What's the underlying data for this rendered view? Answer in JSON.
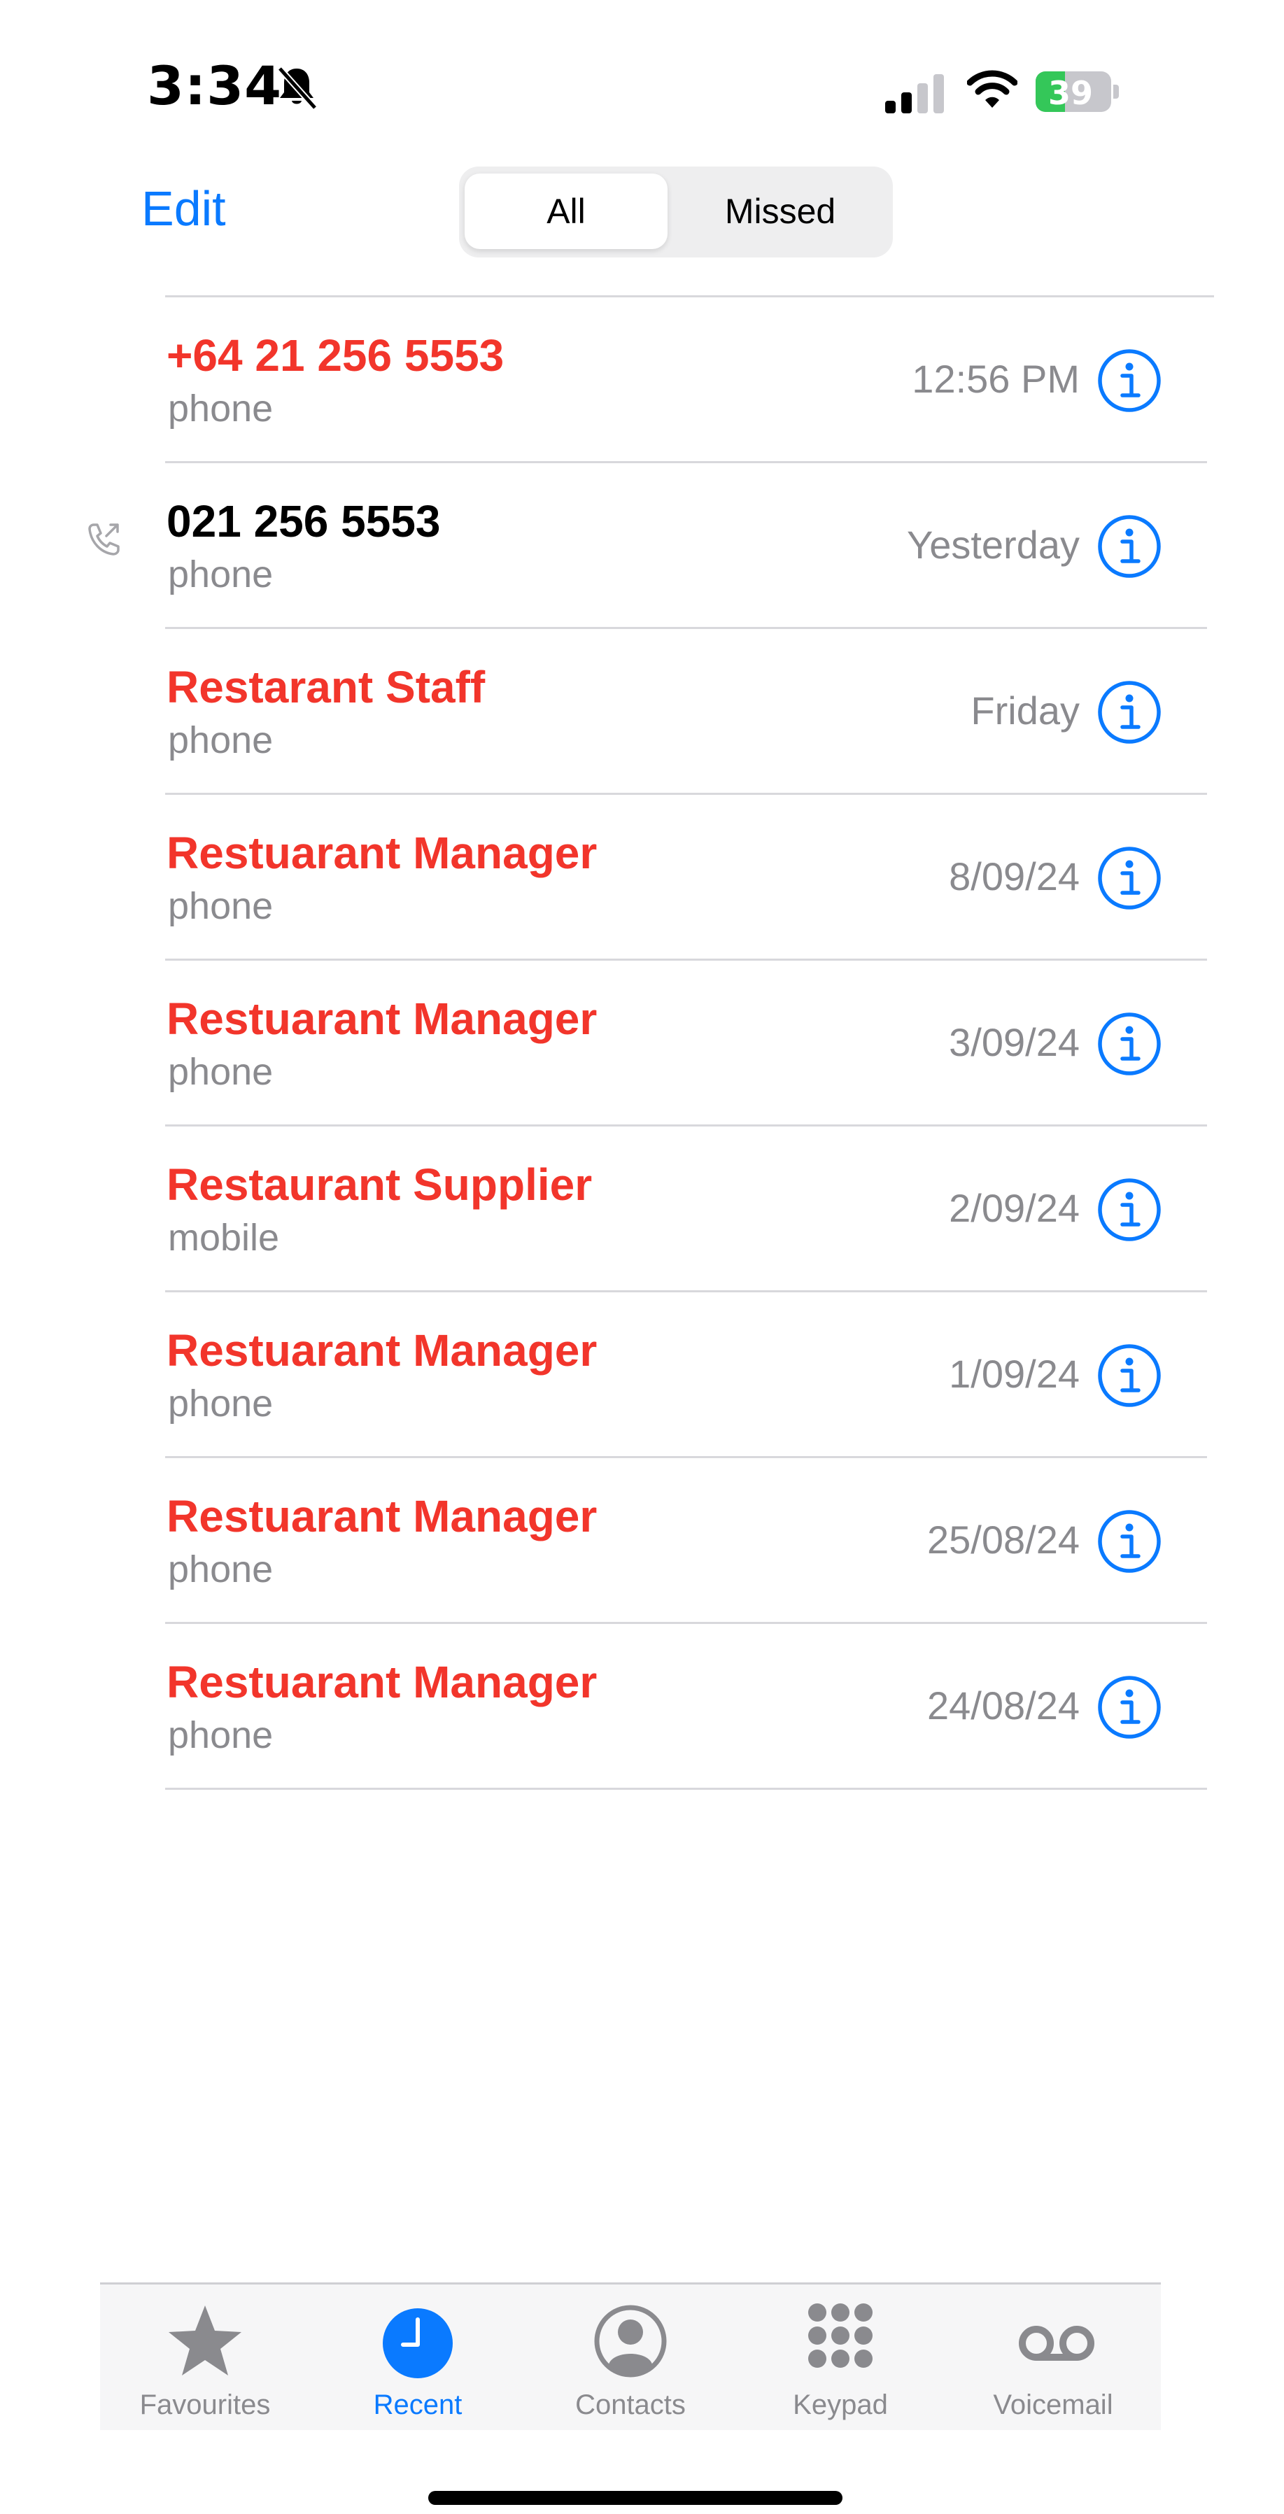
{
  "status_bar": {
    "time": "3:34",
    "battery_level": "39",
    "battery_fraction": 0.39
  },
  "header": {
    "edit_label": "Edit",
    "segments": [
      "All",
      "Missed"
    ],
    "selected_segment": "All"
  },
  "calls": [
    {
      "name": "+64 21 256 5553",
      "type": "phone",
      "time": "12:56 PM",
      "missed": true,
      "outgoing": false
    },
    {
      "name": "021 256 5553",
      "type": "phone",
      "time": "Yesterday",
      "missed": false,
      "outgoing": true
    },
    {
      "name": "Restarant Staff",
      "type": "phone",
      "time": "Friday",
      "missed": true,
      "outgoing": false
    },
    {
      "name": "Restuarant Manager",
      "type": "phone",
      "time": "8/09/24",
      "missed": true,
      "outgoing": false
    },
    {
      "name": "Restuarant Manager",
      "type": "phone",
      "time": "3/09/24",
      "missed": true,
      "outgoing": false
    },
    {
      "name": "Restaurant Supplier",
      "type": "mobile",
      "time": "2/09/24",
      "missed": true,
      "outgoing": false
    },
    {
      "name": "Restuarant Manager",
      "type": "phone",
      "time": "1/09/24",
      "missed": true,
      "outgoing": false
    },
    {
      "name": "Restuarant Manager",
      "type": "phone",
      "time": "25/08/24",
      "missed": true,
      "outgoing": false
    },
    {
      "name": "Restuarant Manager",
      "type": "phone",
      "time": "24/08/24",
      "missed": true,
      "outgoing": false
    }
  ],
  "tab_bar": {
    "tabs": [
      {
        "label": "Favourites",
        "icon": "star-icon"
      },
      {
        "label": "Recent",
        "icon": "clock-icon"
      },
      {
        "label": "Contacts",
        "icon": "person-circle-icon"
      },
      {
        "label": "Keypad",
        "icon": "keypad-icon"
      },
      {
        "label": "Voicemail",
        "icon": "voicemail-icon"
      }
    ],
    "active": "Recent"
  },
  "colors": {
    "accent": "#0a7aff",
    "missed": "#f2352b",
    "secondary_text": "#8a8a8e",
    "battery": "#34c759"
  }
}
